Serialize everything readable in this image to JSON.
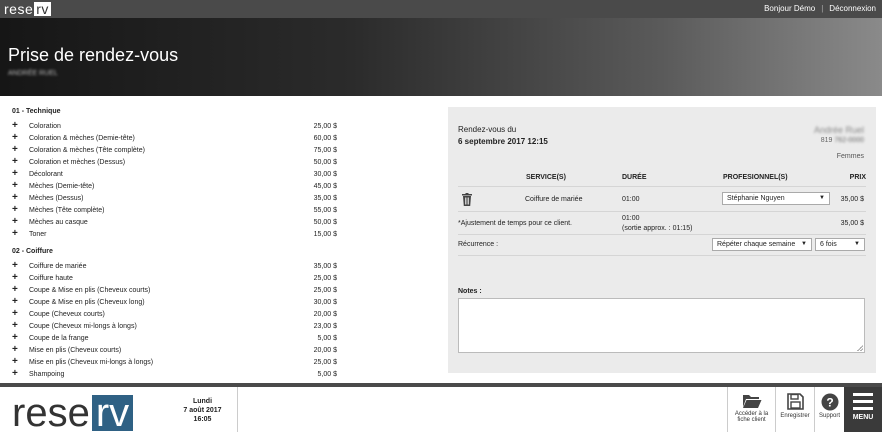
{
  "topbar": {
    "greeting": "Bonjour Démo",
    "logout": "Déconnexion",
    "logo_a": "rese",
    "logo_b": "rv"
  },
  "header": {
    "title": "Prise de rendez-vous",
    "client": "ANDRÉE RUEL"
  },
  "services": {
    "categories": [
      {
        "name": "01 - Technique",
        "items": [
          {
            "name": "Coloration",
            "price": "25,00 $"
          },
          {
            "name": "Coloration & mèches (Demie-tête)",
            "price": "60,00 $"
          },
          {
            "name": "Coloration & mèches (Tête complète)",
            "price": "75,00 $"
          },
          {
            "name": "Coloration et mèches (Dessus)",
            "price": "50,00 $"
          },
          {
            "name": "Décolorant",
            "price": "30,00 $"
          },
          {
            "name": "Mèches (Demie-tête)",
            "price": "45,00 $"
          },
          {
            "name": "Mèches (Dessus)",
            "price": "35,00 $"
          },
          {
            "name": "Mèches (Tête complète)",
            "price": "55,00 $"
          },
          {
            "name": "Mèches au casque",
            "price": "50,00 $"
          },
          {
            "name": "Toner",
            "price": "15,00 $"
          }
        ]
      },
      {
        "name": "02 - Coiffure",
        "items": [
          {
            "name": "Coiffure de mariée",
            "price": "35,00 $"
          },
          {
            "name": "Coiffure haute",
            "price": "25,00 $"
          },
          {
            "name": "Coupe & Mise en plis (Cheveux courts)",
            "price": "25,00 $"
          },
          {
            "name": "Coupe & Mise en plis (Cheveux long)",
            "price": "30,00 $"
          },
          {
            "name": "Coupe (Cheveux courts)",
            "price": "20,00 $"
          },
          {
            "name": "Coupe (Cheveux mi-longs à longs)",
            "price": "23,00 $"
          },
          {
            "name": "Coupe de la frange",
            "price": "5,00 $"
          },
          {
            "name": "Mise en plis (Cheveux courts)",
            "price": "20,00 $"
          },
          {
            "name": "Mise en plis (Cheveux mi-longs à longs)",
            "price": "25,00 $"
          },
          {
            "name": "Shampoing",
            "price": "5,00 $"
          }
        ]
      }
    ]
  },
  "appointment": {
    "label": "Rendez-vous du",
    "date": "6 septembre 2017 12:15",
    "client_name": "Andrée Ruel",
    "client_phone_prefix": "819",
    "client_phone_rest": "762-0000",
    "client_gender": "Femmes",
    "columns": {
      "service": "SERVICE(S)",
      "duration": "DURÉE",
      "professional": "PROFESIONNEL(S)",
      "price": "PRIX"
    },
    "row": {
      "service": "Coiffure de mariée",
      "duration": "01:00",
      "professional": "Stéphanie Nguyen",
      "price": "35,00 $"
    },
    "adjustment": {
      "label": "*Ajustement de temps pour ce client.",
      "duration": "01:00",
      "approx": "(sortie approx. : 01:15)",
      "price": "35,00 $"
    },
    "recurrence": {
      "label": "Récurrence :",
      "mode": "Répéter chaque semaine",
      "count": "6 fois"
    },
    "notes_label": "Notes :"
  },
  "footer": {
    "logo_a": "rese",
    "logo_b": "rv",
    "day": "Lundi",
    "date": "7 août 2017",
    "time": "16:05",
    "client_file_line1": "Accéder à la",
    "client_file_line2": "fiche client",
    "save": "Enregistrer",
    "support": "Support",
    "menu": "MENU"
  }
}
